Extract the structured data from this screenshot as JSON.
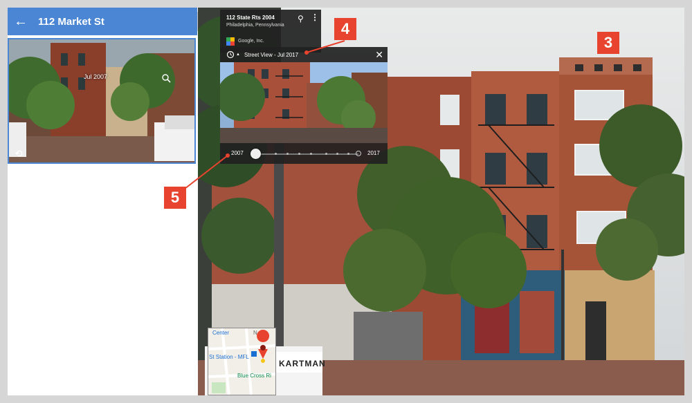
{
  "panel": {
    "title": "112 Market St"
  },
  "info_card": {
    "address": "112 State Rts 2004",
    "city": "Philadelphia, Pennsylvania",
    "owner": "Google, Inc."
  },
  "time_machine": {
    "label": "Street View - Jul 2017",
    "preview_date": "Jul 2007",
    "start_year": "2007",
    "end_year": "2017",
    "selected_fraction": 0.0
  },
  "callouts": {
    "c3": "3",
    "c4": "4",
    "c5": "5"
  },
  "minimap": {
    "center": "Center",
    "station": "St Station - MFL",
    "blue_cross": "Blue Cross Ri",
    "n_label": "N"
  },
  "signage": {
    "kartman": "KARTMAN"
  },
  "colors": {
    "header_blue": "#4a86d4",
    "callout_red": "#e8432e",
    "overlay_dark": "#212121"
  },
  "icons": {
    "back": "arrow-left-icon",
    "pin": "location-pin-icon",
    "more": "more-vert-icon",
    "clock": "history-clock-icon",
    "close": "close-icon",
    "zoom": "zoom-icon",
    "rotate": "rotate-icon",
    "collapse": "chevron-left-icon"
  }
}
